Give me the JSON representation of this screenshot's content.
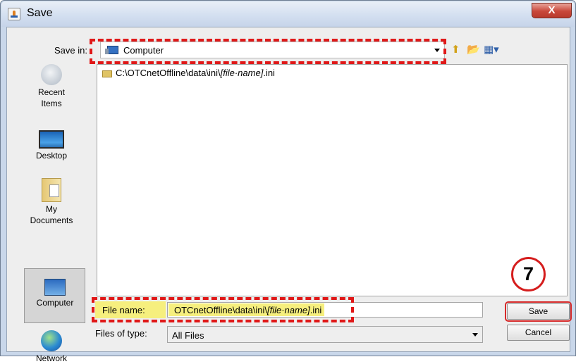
{
  "window": {
    "title": "Save",
    "close_label": "X"
  },
  "save_in": {
    "label": "Save in:",
    "value": "Computer"
  },
  "toolbar": {
    "icons": [
      "up-one-level-icon",
      "create-new-folder-icon",
      "view-menu-icon"
    ]
  },
  "sidebar": {
    "items": [
      {
        "label": "Recent Items",
        "icon": "recent-items-icon"
      },
      {
        "label": "Desktop",
        "icon": "desktop-icon"
      },
      {
        "label": "My Documents",
        "icon": "my-documents-icon"
      },
      {
        "label": "Computer",
        "icon": "computer-icon",
        "selected": true
      },
      {
        "label": "Network",
        "icon": "network-icon"
      }
    ]
  },
  "file_list": {
    "entries": [
      {
        "prefix": "C:\\OTCnetOffline\\data\\ini\\",
        "italic": "[file·name]",
        "suffix": ".ini"
      }
    ]
  },
  "file_name": {
    "label": "File name:",
    "prefix": "OTCnetOffline\\data\\ini\\",
    "italic": "[file·name]",
    "suffix": ".ini"
  },
  "file_type": {
    "label": "Files of type:",
    "value": "All Files"
  },
  "buttons": {
    "save": "Save",
    "cancel": "Cancel"
  },
  "annotation": {
    "step_number": "7"
  },
  "colors": {
    "highlight_dash": "#e01818",
    "highlight_fill": "#f6ef7e",
    "accent": "#3571c2"
  }
}
